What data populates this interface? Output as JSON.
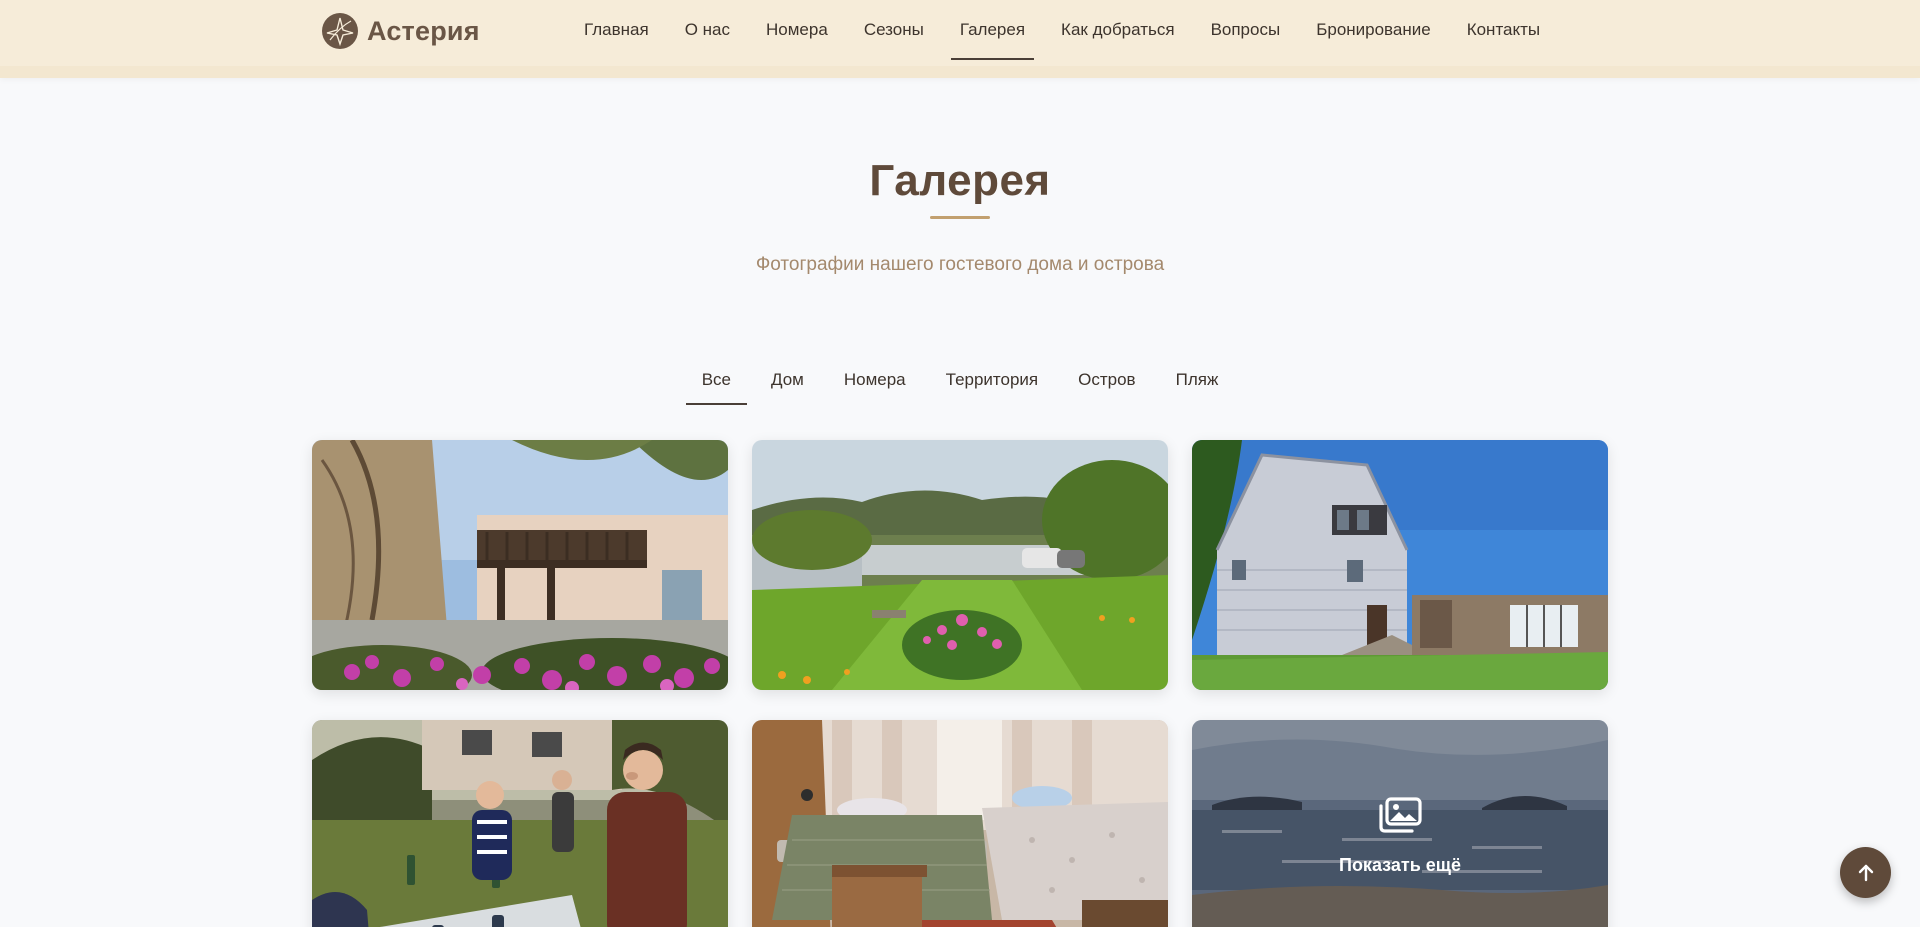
{
  "brand": {
    "name": "Астерия",
    "logo_icon": "compass-star-icon",
    "color": "#6a5646"
  },
  "nav": {
    "items": [
      {
        "label": "Главная",
        "active": false
      },
      {
        "label": "О нас",
        "active": false
      },
      {
        "label": "Номера",
        "active": false
      },
      {
        "label": "Сезоны",
        "active": false
      },
      {
        "label": "Галерея",
        "active": true
      },
      {
        "label": "Как добраться",
        "active": false
      },
      {
        "label": "Вопросы",
        "active": false
      },
      {
        "label": "Бронирование",
        "active": false
      },
      {
        "label": "Контакты",
        "active": false
      }
    ]
  },
  "section": {
    "title": "Галерея",
    "subtitle": "Фотографии нашего гостевого дома и острова"
  },
  "filters": {
    "tabs": [
      {
        "label": "Все",
        "active": true
      },
      {
        "label": "Дом",
        "active": false
      },
      {
        "label": "Номера",
        "active": false
      },
      {
        "label": "Территория",
        "active": false
      },
      {
        "label": "Остров",
        "active": false
      },
      {
        "label": "Пляж",
        "active": false
      }
    ]
  },
  "gallery": {
    "tiles": [
      {
        "scene": "house-with-flowers"
      },
      {
        "scene": "garden-lawn"
      },
      {
        "scene": "white-house"
      },
      {
        "scene": "people-outdoor-table"
      },
      {
        "scene": "twin-bedroom"
      },
      {
        "scene": "beach-sea",
        "overlay_icon": "images-icon"
      }
    ],
    "show_more_label": "Показать ещё"
  },
  "back_to_top": {
    "icon": "arrow-up-icon"
  },
  "colors": {
    "header_bg": "#f6ecd9",
    "accent": "#c2a06f",
    "title": "#5f4a3a",
    "subtitle": "#a4896d",
    "page_bg": "#f8f9fb"
  }
}
